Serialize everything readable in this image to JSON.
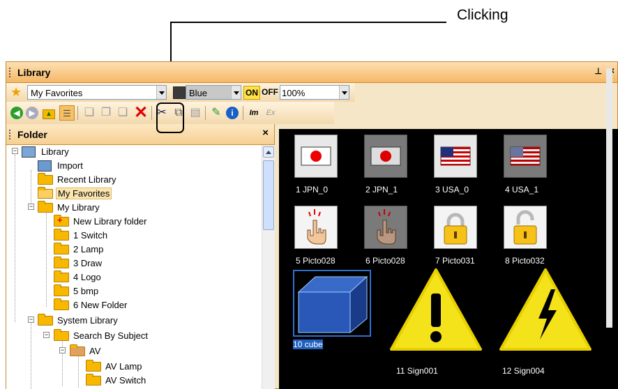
{
  "annotation": {
    "label": "Clicking"
  },
  "window": {
    "title": "Library",
    "pin": "Ͱ",
    "close": "×"
  },
  "toolbar1": {
    "favorites_value": "My Favorites",
    "color_value": "Blue",
    "on_label": "ON",
    "off_label": "OFF",
    "zoom_value": "100%"
  },
  "toolbar2": {
    "icons": [
      "back-icon",
      "forward-icon",
      "up-folder-icon",
      "tree-view-icon",
      "new-folder-icon",
      "new-item-icon",
      "move-icon",
      "delete-icon",
      "cut-icon",
      "copy-icon",
      "paste-icon",
      "edit-icon",
      "info-icon",
      "import-icon",
      "export-icon"
    ],
    "im_label": "Im",
    "ex_label": "Ex"
  },
  "folder": {
    "title": "Folder",
    "close": "×",
    "items": [
      {
        "label": "Library"
      },
      {
        "label": "Import"
      },
      {
        "label": "Recent Library"
      },
      {
        "label": "My Favorites"
      },
      {
        "label": "My Library"
      },
      {
        "label": "New Library folder"
      },
      {
        "label": "1 Switch"
      },
      {
        "label": "2 Lamp"
      },
      {
        "label": "3 Draw"
      },
      {
        "label": "4 Logo"
      },
      {
        "label": "5 bmp"
      },
      {
        "label": "6 New Folder"
      },
      {
        "label": "System Library"
      },
      {
        "label": "Search By Subject"
      },
      {
        "label": "AV"
      },
      {
        "label": "AV Lamp"
      },
      {
        "label": "AV Switch"
      }
    ]
  },
  "items": [
    {
      "label": "1 JPN_0"
    },
    {
      "label": "2 JPN_1"
    },
    {
      "label": "3 USA_0"
    },
    {
      "label": "4 USA_1"
    },
    {
      "label": "5 Picto028"
    },
    {
      "label": "6 Picto028"
    },
    {
      "label": "7 Picto031"
    },
    {
      "label": "8 Picto032"
    },
    {
      "label": "10 cube"
    },
    {
      "label": "11 Sign001"
    },
    {
      "label": "12 Sign004"
    }
  ],
  "colors": {
    "accent": "#f5b868",
    "selection": "#2060c0",
    "warning": "#f4e21a"
  }
}
